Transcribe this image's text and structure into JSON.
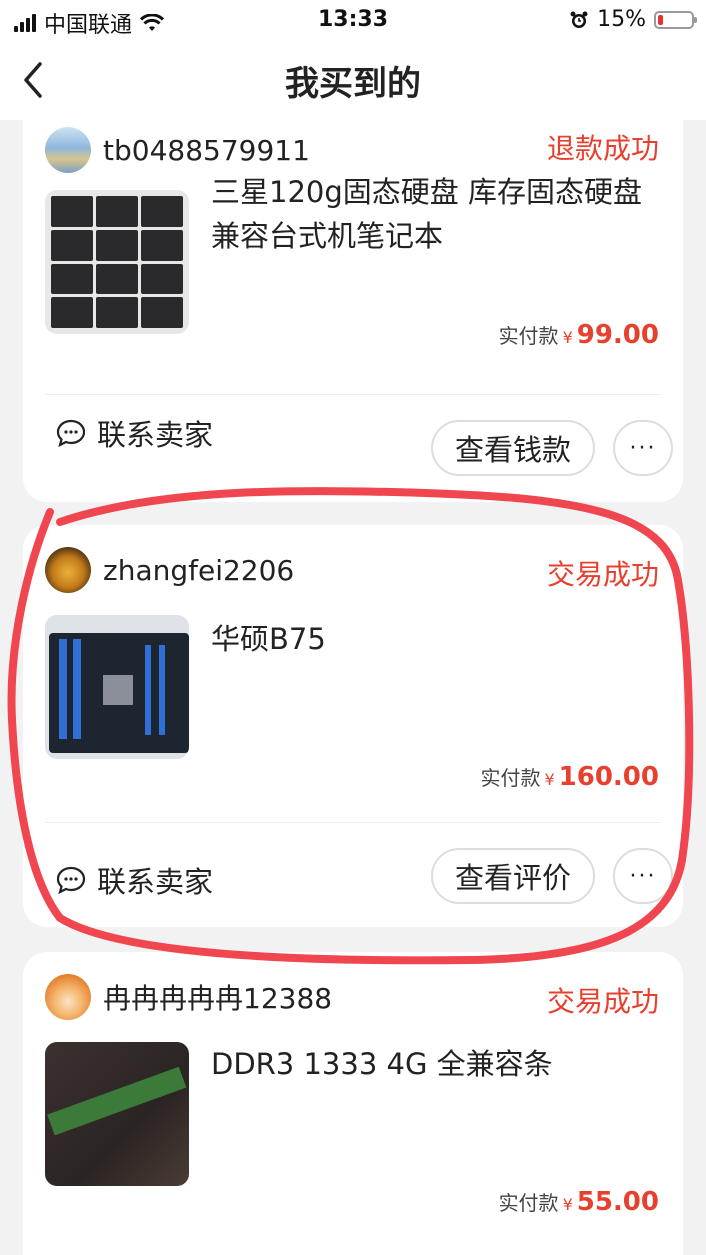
{
  "status_bar": {
    "carrier": "中国联通",
    "time": "13:33",
    "battery": "15%",
    "battery_level": 0.15
  },
  "nav": {
    "title": "我买到的"
  },
  "orders": [
    {
      "shop_name": "tb0488579911",
      "status": "退款成功",
      "title": "三星120g固态硬盘  库存固态硬盘 兼容台式机笔记本",
      "price_label": "实付款",
      "currency": "¥",
      "amount": "99.00",
      "contact": "联系卖家",
      "action": "查看钱款",
      "more": "···"
    },
    {
      "shop_name": "zhangfei2206",
      "status": "交易成功",
      "title": "华硕B75",
      "price_label": "实付款",
      "currency": "¥",
      "amount": "160.00",
      "contact": "联系卖家",
      "action": "查看评价",
      "more": "···"
    },
    {
      "shop_name": "冉冉冉冉冉12388",
      "status": "交易成功",
      "title": "DDR3 1333 4G 全兼容条",
      "price_label": "实付款",
      "currency": "¥",
      "amount": "55.00"
    }
  ],
  "colors": {
    "accent": "#e8402f",
    "annotation": "#f04650"
  }
}
